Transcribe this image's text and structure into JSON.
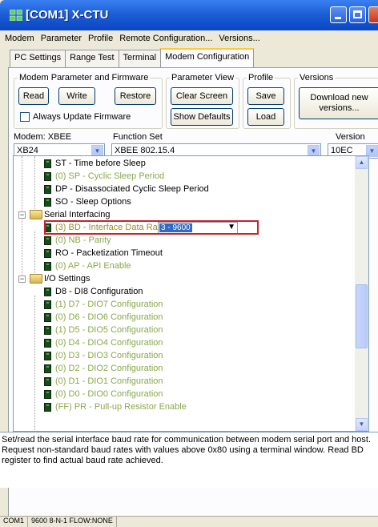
{
  "window": {
    "title": "[COM1] X-CTU"
  },
  "menu": [
    "Modem",
    "Parameter",
    "Profile",
    "Remote Configuration...",
    "Versions..."
  ],
  "tabs": [
    "PC Settings",
    "Range Test",
    "Terminal",
    "Modem Configuration"
  ],
  "groups": {
    "firmware": {
      "legend": "Modem Parameter and Firmware",
      "read": "Read",
      "write": "Write",
      "restore": "Restore",
      "always_update": "Always Update Firmware"
    },
    "param_view": {
      "legend": "Parameter View",
      "clear": "Clear Screen",
      "defaults": "Show Defaults"
    },
    "profile": {
      "legend": "Profile",
      "save": "Save",
      "load": "Load"
    },
    "versions": {
      "legend": "Versions",
      "download": "Download new versions..."
    }
  },
  "modem": {
    "label": "Modem: XBEE",
    "value": "XB24"
  },
  "function_set": {
    "label": "Function Set",
    "value": "XBEE 802.15.4"
  },
  "version": {
    "label": "Version",
    "value": "10EC"
  },
  "tree": {
    "rows": [
      {
        "kind": "param",
        "text": "ST - Time before Sleep",
        "color": "black"
      },
      {
        "kind": "param",
        "text": "(0) SP - Cyclic Sleep Period",
        "color": "green"
      },
      {
        "kind": "param",
        "text": "DP - Disassociated Cyclic Sleep Period",
        "color": "black"
      },
      {
        "kind": "param",
        "text": "SO - Sleep Options",
        "color": "black"
      },
      {
        "kind": "folder",
        "text": "Serial Interfacing"
      },
      {
        "kind": "param",
        "text": "(3) BD - Interface Data Rate",
        "color": "gold"
      },
      {
        "kind": "param",
        "text": "(0) NB - Parity",
        "color": "green"
      },
      {
        "kind": "param",
        "text": "RO - Packetization Timeout",
        "color": "black"
      },
      {
        "kind": "param",
        "text": "(0) AP - API Enable",
        "color": "green"
      },
      {
        "kind": "folder",
        "text": "I/O Settings"
      },
      {
        "kind": "param",
        "text": "D8 - DI8 Configuration",
        "color": "black"
      },
      {
        "kind": "param",
        "text": "(1) D7 - DIO7 Configuration",
        "color": "green"
      },
      {
        "kind": "param",
        "text": "(0) D6 - DIO6 Configuration",
        "color": "green"
      },
      {
        "kind": "param",
        "text": "(1) D5 - DIO5 Configuration",
        "color": "green"
      },
      {
        "kind": "param",
        "text": "(0) D4 - DIO4 Configuration",
        "color": "green"
      },
      {
        "kind": "param",
        "text": "(0) D3 - DIO3 Configuration",
        "color": "green"
      },
      {
        "kind": "param",
        "text": "(0) D2 - DIO2 Configuration",
        "color": "green"
      },
      {
        "kind": "param",
        "text": "(0) D1 - DIO1 Configuration",
        "color": "green"
      },
      {
        "kind": "param",
        "text": "(0) D0 - DIO0 Configuration",
        "color": "green"
      },
      {
        "kind": "param",
        "text": "(FF) PR - Pull-up Resistor Enable",
        "color": "green"
      }
    ],
    "bd_value": "3 - 9600"
  },
  "description": "Set/read the serial interface baud rate for communication between modem serial port and host. Request non-standard baud rates with values above 0x80 using a terminal window. Read BD register to find actual baud rate achieved.",
  "status": {
    "port": "COM1",
    "settings": "9600 8-N-1  FLOW:NONE"
  }
}
